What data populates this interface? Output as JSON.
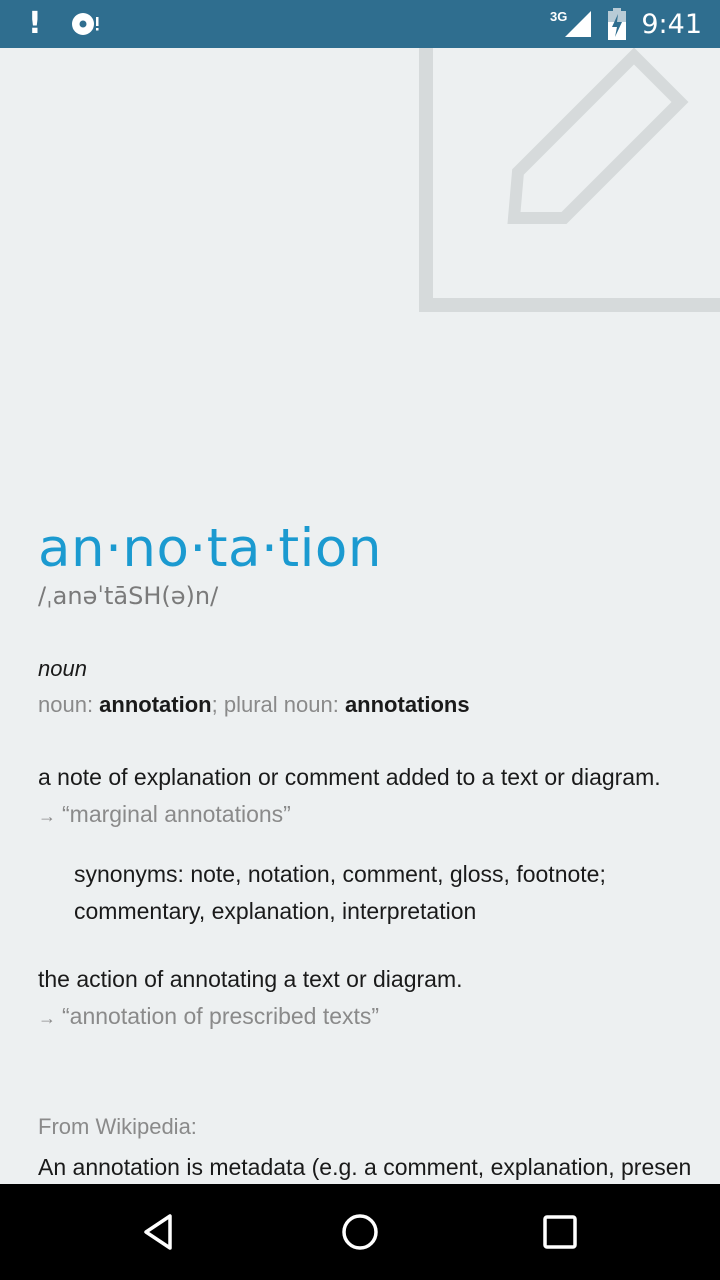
{
  "status_bar": {
    "alert_glyph": "!",
    "network_type": "3G",
    "time": "9:41",
    "icons": [
      "alert-icon",
      "disc-sync-icon",
      "signal-icon",
      "battery-charging-icon"
    ]
  },
  "entry": {
    "headword": "an·no·ta·tion",
    "phonetic": "/ˌanəˈtāSH(ə)n/",
    "part_of_speech": "noun",
    "forms": {
      "noun_label": "noun: ",
      "noun_value": "annotation",
      "separator": "; ",
      "plural_label": "plural noun: ",
      "plural_value": "annotations"
    },
    "senses": [
      {
        "definition": "a note of explanation or comment added to a text or diagram.",
        "example": "“marginal annotations”",
        "synonyms_label": "synonyms: ",
        "synonyms_line1": "note, notation, comment, gloss, footnote;",
        "synonyms_line2": "commentary, explanation, interpretation"
      },
      {
        "definition": "the action of annotating a text or diagram.",
        "example": "“annotation of prescribed texts”"
      }
    ],
    "example_arrow": "→"
  },
  "wikipedia": {
    "label": "From Wikipedia:",
    "text": "An annotation is metadata (e.g. a comment, explanation, presen"
  },
  "nav_bar": {
    "icons": [
      "back-icon",
      "home-icon",
      "recents-icon"
    ]
  },
  "colors": {
    "status_bar": "#2f6e8f",
    "background": "#edf0f1",
    "headword": "#1b9ad0",
    "muted": "#8a8a8a",
    "art": "#d6dadb"
  }
}
